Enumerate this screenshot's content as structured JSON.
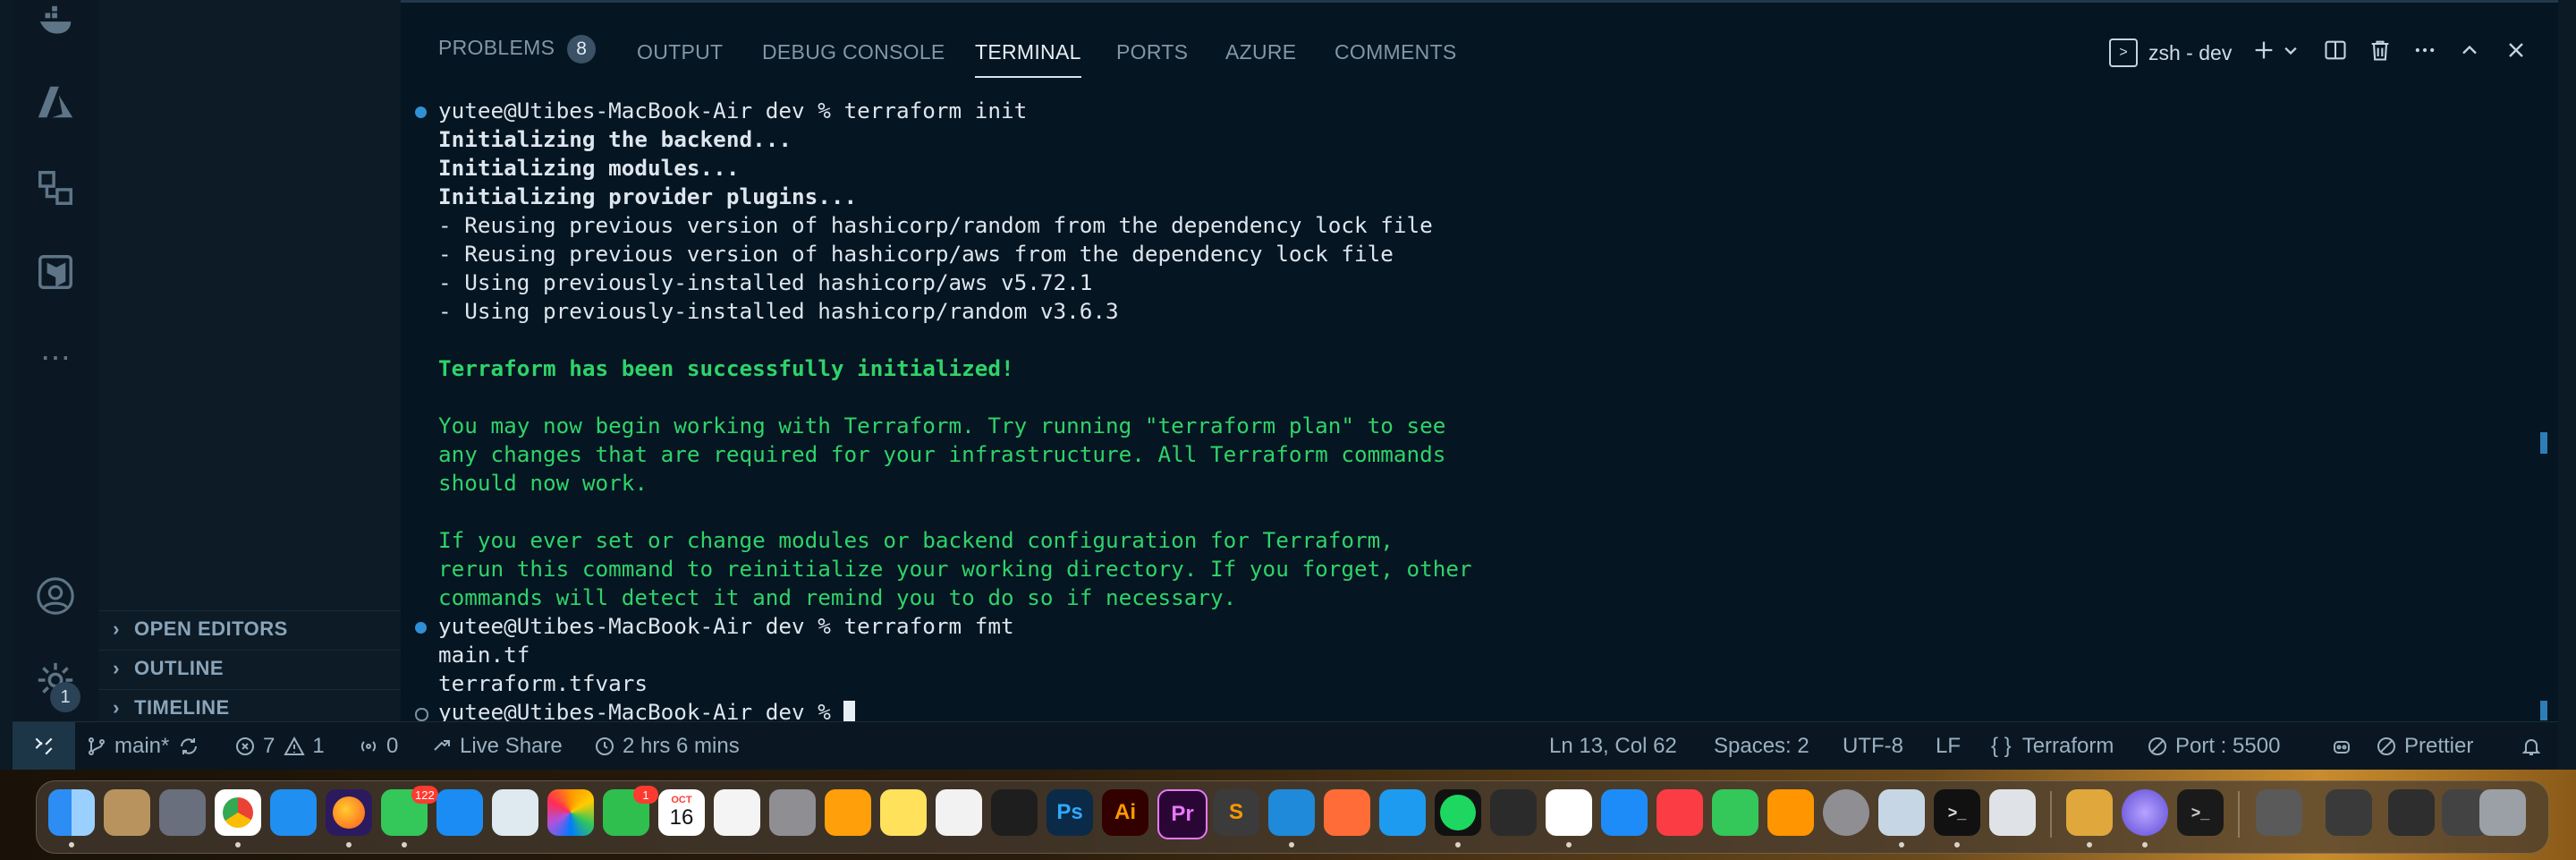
{
  "sidebar": {
    "sections": [
      {
        "label": "OPEN EDITORS"
      },
      {
        "label": "OUTLINE"
      },
      {
        "label": "TIMELINE"
      }
    ],
    "accounts_badge": "1"
  },
  "panel": {
    "tabs": [
      {
        "label": "PROBLEMS",
        "count": "8"
      },
      {
        "label": "OUTPUT"
      },
      {
        "label": "DEBUG CONSOLE"
      },
      {
        "label": "TERMINAL"
      },
      {
        "label": "PORTS"
      },
      {
        "label": "AZURE"
      },
      {
        "label": "COMMENTS"
      }
    ],
    "terminal_name": "zsh - dev"
  },
  "terminal": {
    "lines": [
      "yutee@Utibes-MacBook-Air dev % terraform init",
      "Initializing the backend...",
      "Initializing modules...",
      "Initializing provider plugins...",
      "- Reusing previous version of hashicorp/random from the dependency lock file",
      "- Reusing previous version of hashicorp/aws from the dependency lock file",
      "- Using previously-installed hashicorp/aws v5.72.1",
      "- Using previously-installed hashicorp/random v3.6.3",
      "Terraform has been successfully initialized!",
      "You may now begin working with Terraform. Try running \"terraform plan\" to see",
      "any changes that are required for your infrastructure. All Terraform commands",
      "should now work.",
      "If you ever set or change modules or backend configuration for Terraform,",
      "rerun this command to reinitialize your working directory. If you forget, other",
      "commands will detect it and remind you to do so if necessary.",
      "yutee@Utibes-MacBook-Air dev % terraform fmt",
      "main.tf",
      "terraform.tfvars",
      "yutee@Utibes-MacBook-Air dev % "
    ]
  },
  "statusbar": {
    "branch": "main*",
    "errors": "7",
    "warnings": "1",
    "ports": "0",
    "live_share": "Live Share",
    "time": "2 hrs 6 mins",
    "position": "Ln 13, Col 62",
    "spaces": "Spaces: 2",
    "encoding": "UTF-8",
    "eol": "LF",
    "language": "Terraform",
    "port": "Port : 5500",
    "prettier": "Prettier"
  },
  "dock": {
    "badges": {
      "messages": "122",
      "facetime": "1",
      "calendar_month": "OCT",
      "calendar_day": "16"
    },
    "labels": {
      "photoshop": "Ps",
      "illustrator": "Ai",
      "premiere": "Pr"
    }
  },
  "colors": {
    "accent": "#2f90d6",
    "terminal_green": "#2fd36a",
    "panel_bg": "#051521"
  }
}
